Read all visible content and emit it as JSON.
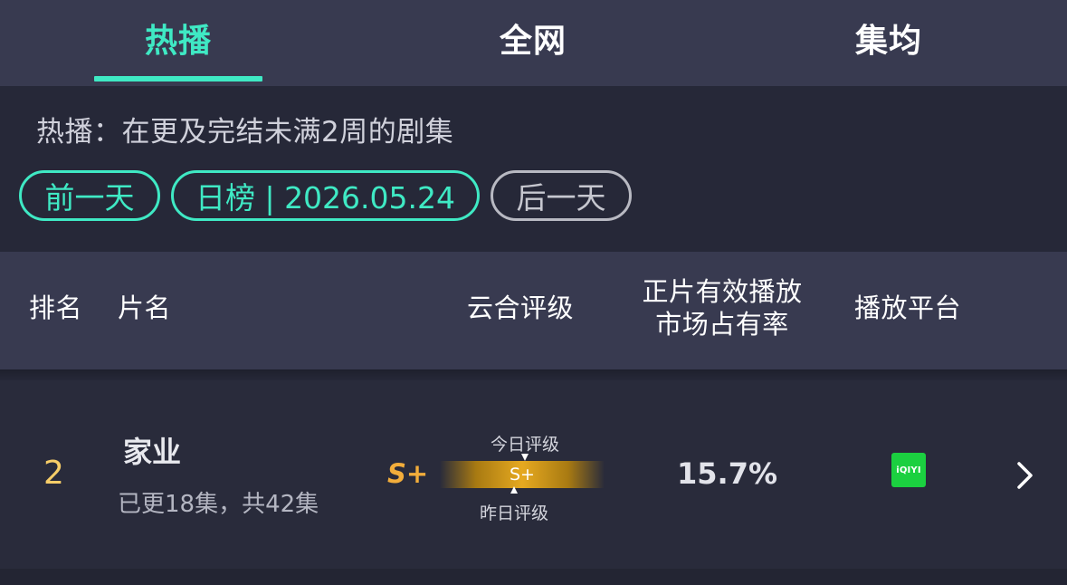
{
  "tabs": [
    {
      "label": "热播",
      "active": true
    },
    {
      "label": "全网",
      "active": false
    },
    {
      "label": "集均",
      "active": false
    }
  ],
  "description": "热播：在更及完结未满2周的剧集",
  "date_nav": {
    "prev_label": "前一天",
    "current_label": "日榜 | 2026.05.24",
    "next_label": "后一天"
  },
  "table": {
    "headers": {
      "rank": "排名",
      "title": "片名",
      "grade": "云合评级",
      "share_line1": "正片有效播放",
      "share_line2": "市场占有率",
      "platform": "播放平台"
    },
    "rows": [
      {
        "rank": "2",
        "title": "家业",
        "subtitle": "已更18集，共42集",
        "grade": "S+",
        "grade_bar": "S+",
        "grade_today_label": "今日评级",
        "grade_yesterday_label": "昨日评级",
        "share": "15.7%",
        "platform_logo": "iQIYI",
        "platform_icon": "iqiyi-logo-icon"
      }
    ]
  },
  "colors": {
    "accent": "#3fe9c4",
    "rank": "#f6cd68",
    "grade": "#f2ad3b",
    "platform": "#1bd040",
    "header_bg": "#383a50",
    "page_bg": "#262838"
  }
}
